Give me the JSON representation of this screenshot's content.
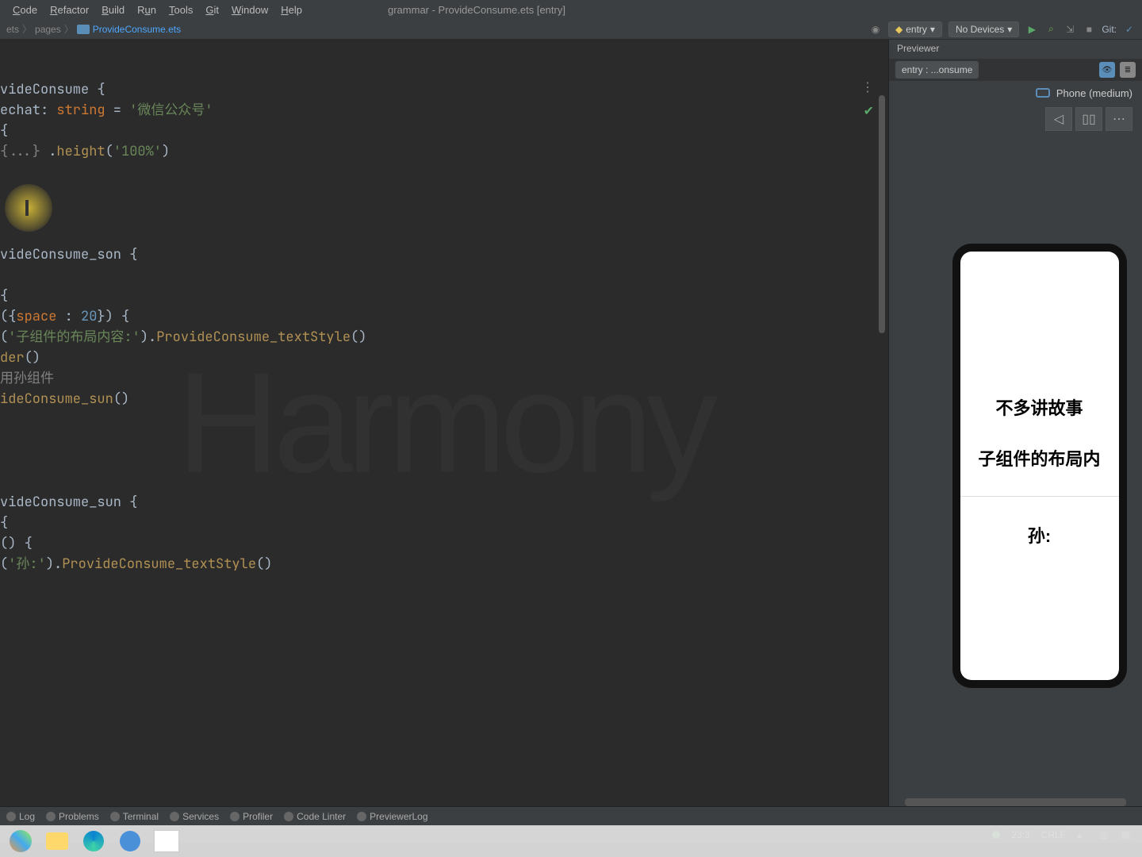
{
  "menu": {
    "code": "Code",
    "refactor": "Refactor",
    "build": "Build",
    "run": "Run",
    "tools": "Tools",
    "git": "Git",
    "window": "Window",
    "help": "Help"
  },
  "window_title": "grammar - ProvideConsume.ets [entry]",
  "breadcrumb": {
    "root": "ets",
    "pages": "pages",
    "file": "ProvideConsume.ets"
  },
  "toolbar": {
    "entry": "entry",
    "no_devices": "No Devices",
    "git": "Git:"
  },
  "previewer": {
    "title": "Previewer",
    "tab": "entry : ...onsume",
    "device": "Phone (medium)",
    "phone_text1": "不多讲故事",
    "phone_text2": "子组件的布局内",
    "phone_text3": "孙:"
  },
  "code": {
    "l1_a": "videConsume {",
    "l2_a": "echat: ",
    "l2_b": "string",
    "l2_c": " = ",
    "l2_d": "'微信公众号'",
    "l3_a": "{",
    "l4_a": "{...}",
    "l4_b": " .",
    "l4_c": "height",
    "l4_d": "(",
    "l4_e": "'100%'",
    "l4_f": ")",
    "l5_a": "videConsume_son {",
    "l6_a": "{",
    "l7_a": "({",
    "l7_b": "space ",
    "l7_c": ": ",
    "l7_d": "20",
    "l7_e": "}) {",
    "l8_a": "(",
    "l8_b": "'子组件的布局内容:'",
    "l8_c": ").",
    "l8_d": "ProvideConsume_textStyle",
    "l8_e": "()",
    "l9_a": "der",
    "l9_b": "()",
    "l10_a": "用孙组件",
    "l11_a": "ideConsume_sun",
    "l11_b": "()",
    "l12_a": "videConsume_sun {",
    "l13_a": "{",
    "l14_a": "() {",
    "l15_a": "(",
    "l15_b": "'孙:'",
    "l15_c": ").",
    "l15_d": "ProvideConsume_textStyle",
    "l15_e": "()"
  },
  "bottom_tabs": {
    "log": "Log",
    "problems": "Problems",
    "terminal": "Terminal",
    "services": "Services",
    "profiler": "Profiler",
    "codelinter": "Code Linter",
    "previewerlog": "PreviewerLog"
  },
  "status": {
    "pos": "23:3",
    "enc": "CRLF"
  },
  "watermark": "Harmony"
}
